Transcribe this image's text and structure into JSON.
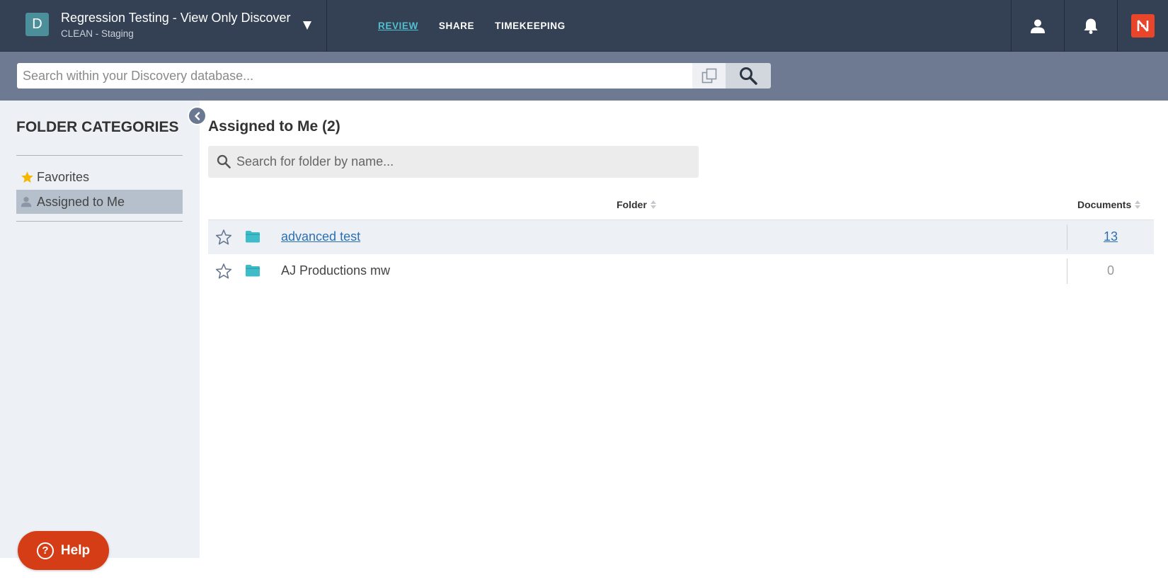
{
  "project": {
    "badge_letter": "D",
    "title": "Regression Testing - View Only Discover",
    "subtitle": "CLEAN - Staging"
  },
  "nav": {
    "review": "REVIEW",
    "share": "SHARE",
    "timekeeping": "TIMEKEEPING",
    "active": "review"
  },
  "search": {
    "placeholder": "Search within your Discovery database...",
    "value": ""
  },
  "sidebar": {
    "title": "FOLDER CATEGORIES",
    "items": [
      {
        "label": "Favorites",
        "icon": "star-icon",
        "selected": false
      },
      {
        "label": "Assigned to Me",
        "icon": "user-icon",
        "selected": true
      }
    ]
  },
  "main": {
    "title": "Assigned to Me (2)",
    "folder_search_placeholder": "Search for folder by name...",
    "columns": {
      "folder": "Folder",
      "documents": "Documents"
    },
    "rows": [
      {
        "name": "advanced test",
        "documents": "13",
        "linked": true
      },
      {
        "name": "AJ Productions mw",
        "documents": "0",
        "linked": false
      }
    ]
  },
  "help": {
    "label": "Help"
  },
  "colors": {
    "topbar": "#344053",
    "accent": "#4fc0cf",
    "searchband": "#6d7a91",
    "sidebar": "#edf1f5",
    "link": "#2c6fb3",
    "help": "#d43d16",
    "brand": "#e8452a",
    "folder_icon": "#3fbcc9"
  }
}
